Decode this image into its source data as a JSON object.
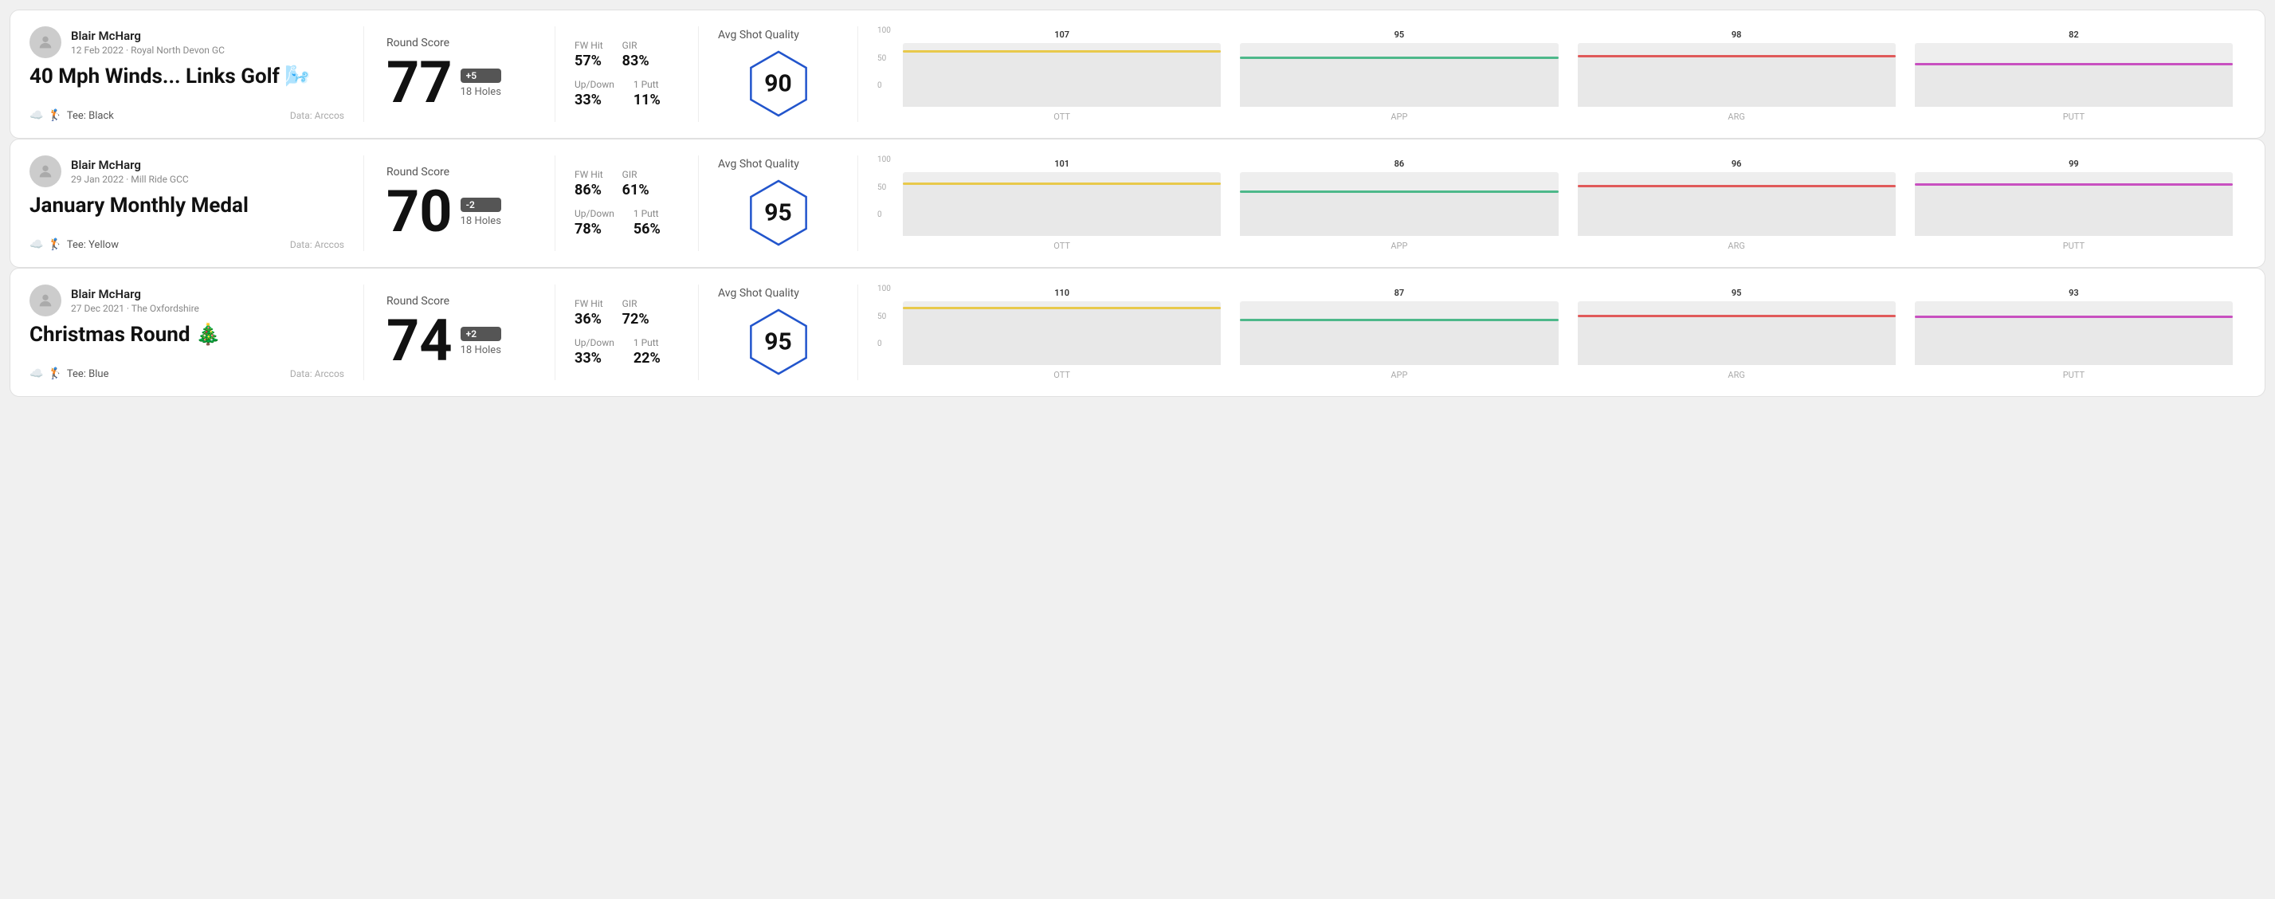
{
  "rounds": [
    {
      "id": "round1",
      "player_name": "Blair McHarg",
      "date": "12 Feb 2022 · Royal North Devon GC",
      "title": "40 Mph Winds... Links Golf 🌬️",
      "tee": "Black",
      "data_source": "Data: Arccos",
      "round_score_label": "Round Score",
      "score": "77",
      "score_badge": "+5",
      "holes": "18 Holes",
      "fw_hit_label": "FW Hit",
      "fw_hit": "57%",
      "gir_label": "GIR",
      "gir": "83%",
      "updown_label": "Up/Down",
      "updown": "33%",
      "oneputt_label": "1 Putt",
      "oneputt": "11%",
      "avg_quality_label": "Avg Shot Quality",
      "quality_score": "90",
      "chart": {
        "bars": [
          {
            "label": "OTT",
            "value": 107,
            "color": "#e8c94b"
          },
          {
            "label": "APP",
            "value": 95,
            "color": "#4db88a"
          },
          {
            "label": "ARG",
            "value": 98,
            "color": "#e05a5a"
          },
          {
            "label": "PUTT",
            "value": 82,
            "color": "#c850c0"
          }
        ]
      }
    },
    {
      "id": "round2",
      "player_name": "Blair McHarg",
      "date": "29 Jan 2022 · Mill Ride GCC",
      "title": "January Monthly Medal",
      "tee": "Yellow",
      "data_source": "Data: Arccos",
      "round_score_label": "Round Score",
      "score": "70",
      "score_badge": "-2",
      "holes": "18 Holes",
      "fw_hit_label": "FW Hit",
      "fw_hit": "86%",
      "gir_label": "GIR",
      "gir": "61%",
      "updown_label": "Up/Down",
      "updown": "78%",
      "oneputt_label": "1 Putt",
      "oneputt": "56%",
      "avg_quality_label": "Avg Shot Quality",
      "quality_score": "95",
      "chart": {
        "bars": [
          {
            "label": "OTT",
            "value": 101,
            "color": "#e8c94b"
          },
          {
            "label": "APP",
            "value": 86,
            "color": "#4db88a"
          },
          {
            "label": "ARG",
            "value": 96,
            "color": "#e05a5a"
          },
          {
            "label": "PUTT",
            "value": 99,
            "color": "#c850c0"
          }
        ]
      }
    },
    {
      "id": "round3",
      "player_name": "Blair McHarg",
      "date": "27 Dec 2021 · The Oxfordshire",
      "title": "Christmas Round 🎄",
      "tee": "Blue",
      "data_source": "Data: Arccos",
      "round_score_label": "Round Score",
      "score": "74",
      "score_badge": "+2",
      "holes": "18 Holes",
      "fw_hit_label": "FW Hit",
      "fw_hit": "36%",
      "gir_label": "GIR",
      "gir": "72%",
      "updown_label": "Up/Down",
      "updown": "33%",
      "oneputt_label": "1 Putt",
      "oneputt": "22%",
      "avg_quality_label": "Avg Shot Quality",
      "quality_score": "95",
      "chart": {
        "bars": [
          {
            "label": "OTT",
            "value": 110,
            "color": "#e8c94b"
          },
          {
            "label": "APP",
            "value": 87,
            "color": "#4db88a"
          },
          {
            "label": "ARG",
            "value": 95,
            "color": "#e05a5a"
          },
          {
            "label": "PUTT",
            "value": 93,
            "color": "#c850c0"
          }
        ]
      }
    }
  ],
  "y_axis": [
    "100",
    "50",
    "0"
  ]
}
